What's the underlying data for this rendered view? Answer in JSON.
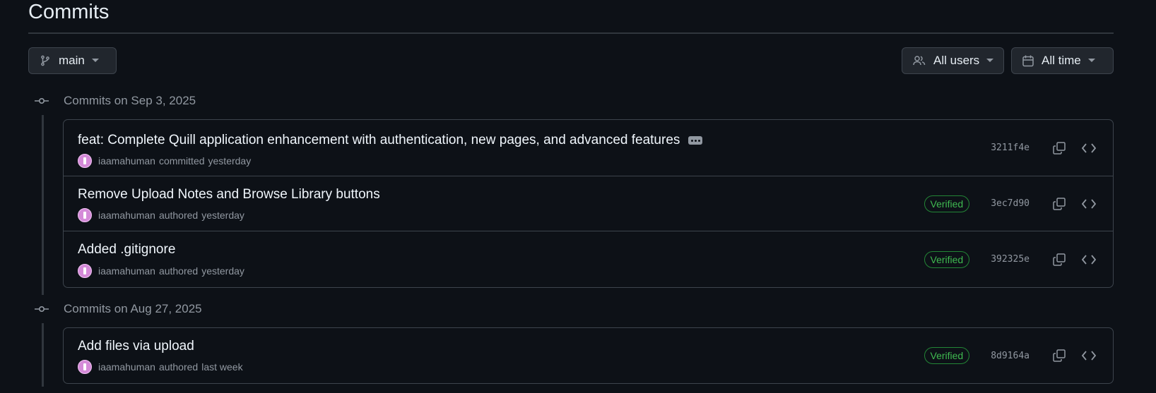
{
  "page": {
    "title": "Commits"
  },
  "filters": {
    "branch": {
      "label": "main",
      "icon": "git-branch-icon"
    },
    "users": {
      "label": "All users",
      "icon": "people-icon"
    },
    "time": {
      "label": "All time",
      "icon": "calendar-icon"
    }
  },
  "groups": [
    {
      "date_label": "Commits on Sep 3, 2025",
      "commits": [
        {
          "message": "feat: Complete Quill application enhancement with authentication, new pages, and advanced features",
          "author": "iaamahuman",
          "action": "committed",
          "when": "yesterday",
          "verified": false,
          "verified_label": "",
          "sha": "3211f4e",
          "has_more": true
        },
        {
          "message": "Remove Upload Notes and Browse Library buttons",
          "author": "iaamahuman",
          "action": "authored",
          "when": "yesterday",
          "verified": true,
          "verified_label": "Verified",
          "sha": "3ec7d90",
          "has_more": false
        },
        {
          "message": "Added .gitignore",
          "author": "iaamahuman",
          "action": "authored",
          "when": "yesterday",
          "verified": true,
          "verified_label": "Verified",
          "sha": "392325e",
          "has_more": false
        }
      ]
    },
    {
      "date_label": "Commits on Aug 27, 2025",
      "commits": [
        {
          "message": "Add files via upload",
          "author": "iaamahuman",
          "action": "authored",
          "when": "last week",
          "verified": true,
          "verified_label": "Verified",
          "sha": "8d9164a",
          "has_more": false
        }
      ]
    }
  ],
  "colors": {
    "background": "#0d1117",
    "border": "#3d444d",
    "verified": "#3fb950",
    "avatar": "#d48ad8"
  }
}
